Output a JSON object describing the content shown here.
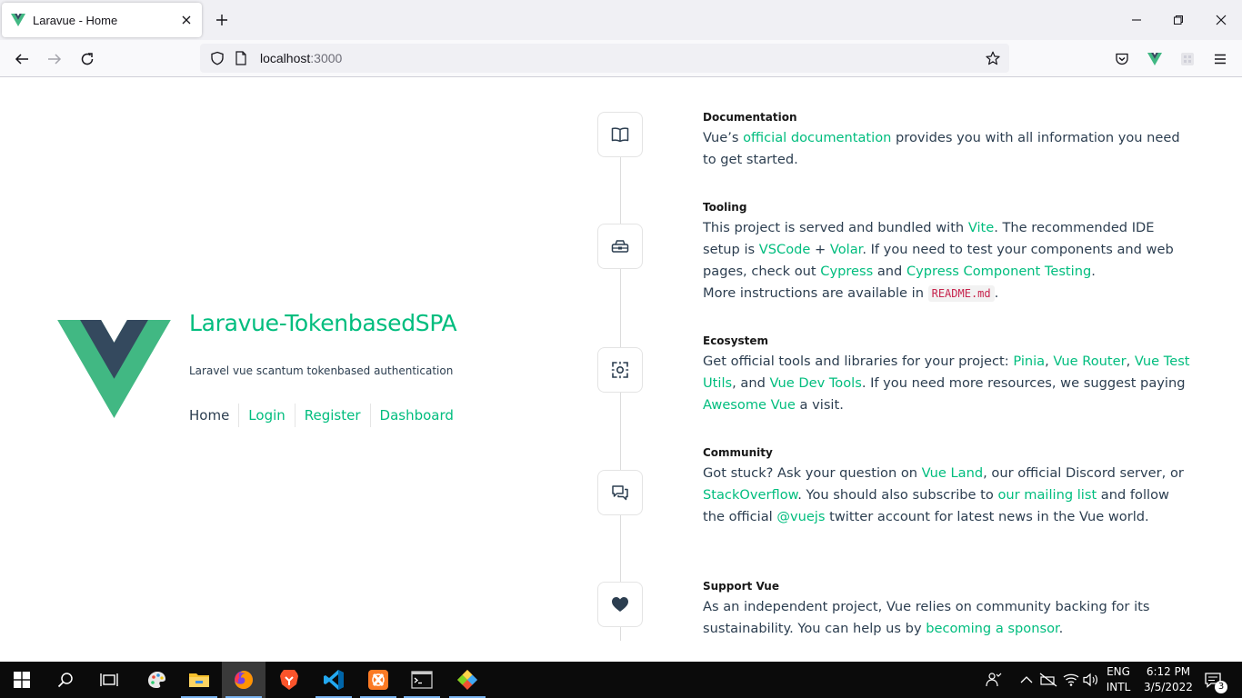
{
  "browser": {
    "tab_title": "Laravue - Home",
    "url_host": "localhost",
    "url_port": ":3000",
    "icons": [
      "vue-favicon",
      "close-icon",
      "plus-icon",
      "minimize-icon",
      "restore-icon",
      "window-close-icon",
      "back-icon",
      "forward-icon",
      "reload-icon",
      "shield-icon",
      "page-icon",
      "star-icon",
      "pocket-icon",
      "vue-devtools-icon",
      "extension-icon",
      "menu-icon"
    ]
  },
  "hero": {
    "title": "Laravue-TokenbasedSPA",
    "subtitle": "Laravel vue scantum tokenbased authentication",
    "nav": [
      "Home",
      "Login",
      "Register",
      "Dashboard"
    ]
  },
  "items": {
    "documentation": {
      "heading": "Documentation",
      "t1": "Vue’s ",
      "l1": "official documentation",
      "t2": " provides you with all information you need to get started."
    },
    "tooling": {
      "heading": "Tooling",
      "t1": "This project is served and bundled with ",
      "l1": "Vite",
      "t2": ". The recommended IDE setup is ",
      "l2": "VSCode",
      "t3": " + ",
      "l3": "Volar",
      "t4": ". If you need to test your components and web pages, check out ",
      "l4": "Cypress",
      "t5": " and ",
      "l5": "Cypress Component Testing",
      "t6": ".",
      "t7": "More instructions are available in ",
      "code": "README.md",
      "t8": "."
    },
    "ecosystem": {
      "heading": "Ecosystem",
      "t1": "Get official tools and libraries for your project: ",
      "l1": "Pinia",
      "t2": ", ",
      "l2": "Vue Router",
      "t3": ", ",
      "l3": "Vue Test Utils",
      "t4": ", and ",
      "l4": "Vue Dev Tools",
      "t5": ". If you need more resources, we suggest paying ",
      "l5": "Awesome Vue",
      "t6": " a visit."
    },
    "community": {
      "heading": "Community",
      "t1": "Got stuck? Ask your question on ",
      "l1": "Vue Land",
      "t2": ", our official Discord server, or ",
      "l2": "StackOverflow",
      "t3": ". You should also subscribe to ",
      "l3": "our mailing list",
      "t4": " and follow the official ",
      "l4": "@vuejs",
      "t5": " twitter account for latest news in the Vue world."
    },
    "support": {
      "heading": "Support Vue",
      "t1": "As an independent project, Vue relies on community backing for its sustainability. You can help us by ",
      "l1": "becoming a sponsor",
      "t2": "."
    }
  },
  "taskbar": {
    "apps": [
      "start-icon",
      "search-icon",
      "task-view-icon",
      "paint-icon",
      "file-explorer-icon",
      "firefox-icon",
      "brave-icon",
      "vscode-icon",
      "xampp-icon",
      "terminal-icon",
      "git-icon"
    ],
    "lang_line1": "ENG",
    "lang_line2": "INTL",
    "time": "6:12 PM",
    "date": "3/5/2022",
    "notification_count": "3"
  },
  "colors": {
    "vue_green": "#41b883",
    "vue_dark": "#34495e",
    "link_green": "#00bd7e",
    "text": "#2c3e50"
  }
}
